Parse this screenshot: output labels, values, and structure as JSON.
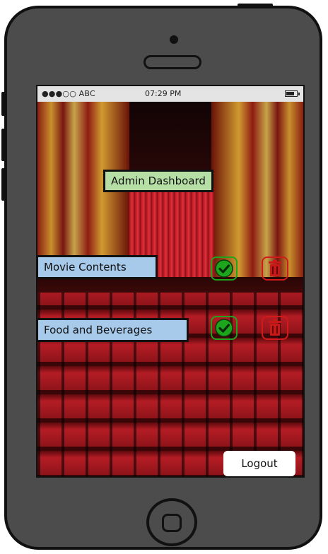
{
  "status_bar": {
    "carrier": "●●●○○ ABC",
    "time": "07:29 PM",
    "battery_icon": "battery-icon"
  },
  "header": {
    "title": "Admin Dashboard"
  },
  "sections": [
    {
      "label": "Movie Contents",
      "approve_icon": "check-circle-icon",
      "delete_icon": "trash-icon"
    },
    {
      "label": "Food and Beverages",
      "approve_icon": "check-circle-icon",
      "delete_icon": "trash-icon"
    }
  ],
  "logout_label": "Logout",
  "colors": {
    "header_bg": "#b6dfa6",
    "section_bg": "#a7c9ea",
    "approve": "#1ea51e",
    "delete": "#d11b1b",
    "phone_body": "#4c4c4c"
  }
}
